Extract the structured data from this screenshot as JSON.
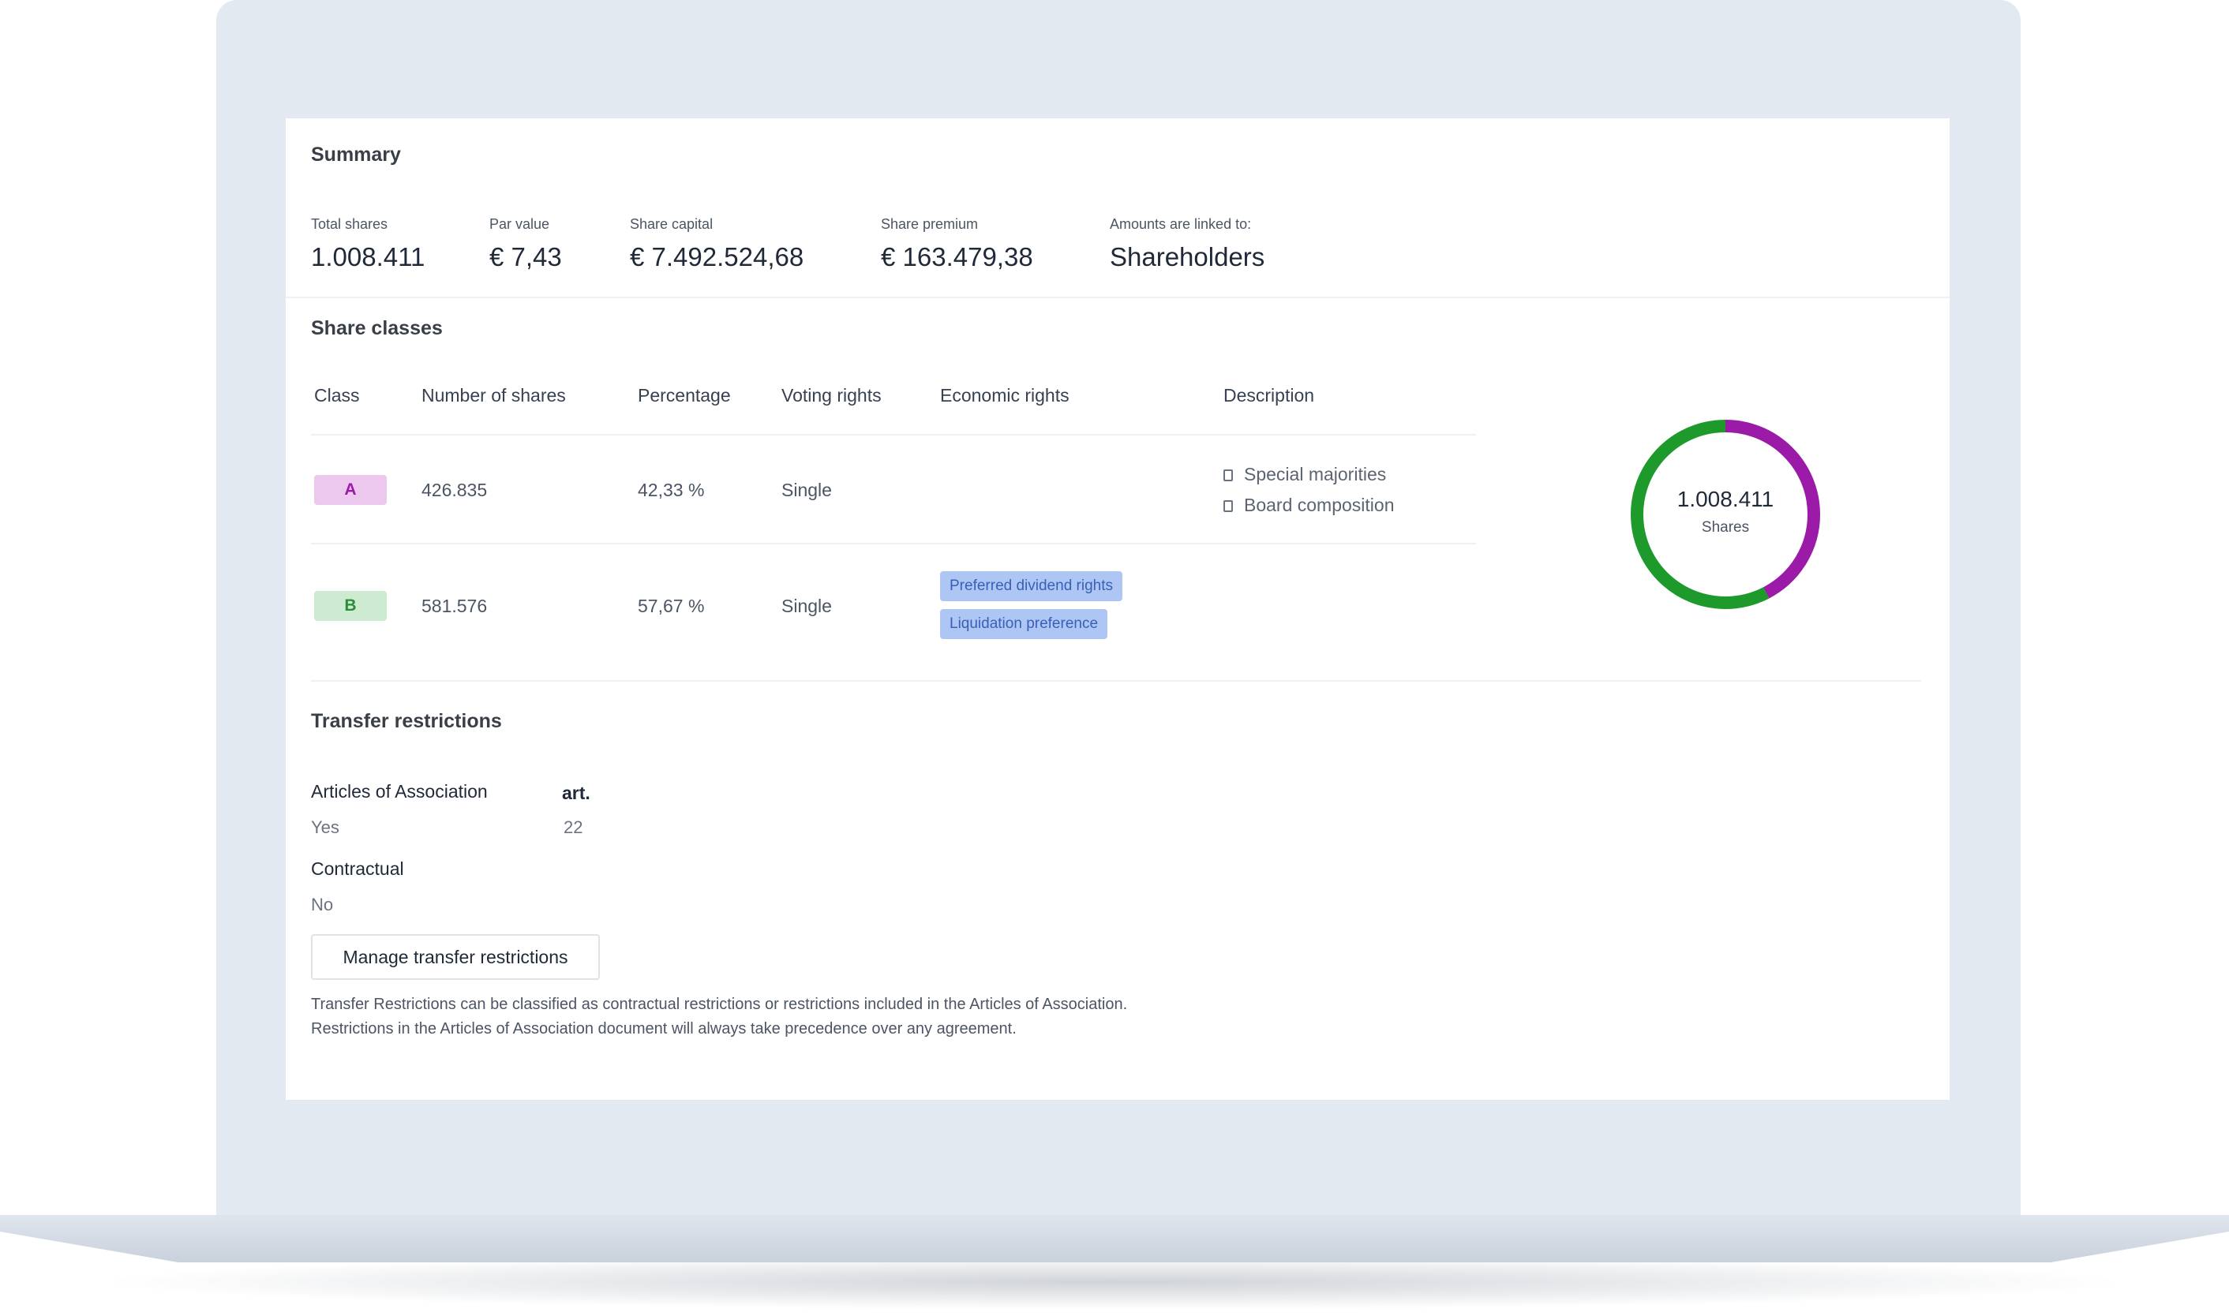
{
  "summary": {
    "title": "Summary",
    "metrics": [
      {
        "label": "Total shares",
        "value": "1.008.411"
      },
      {
        "label": "Par value",
        "value": "€ 7,43"
      },
      {
        "label": "Share capital",
        "value": "€ 7.492.524,68"
      },
      {
        "label": "Share premium",
        "value": "€ 163.479,38"
      },
      {
        "label": "Amounts are linked to:",
        "value": "Shareholders"
      }
    ]
  },
  "share_classes": {
    "title": "Share classes",
    "columns": [
      "Class",
      "Number of shares",
      "Percentage",
      "Voting rights",
      "Economic rights",
      "Description"
    ],
    "rows": [
      {
        "class": "A",
        "shares": "426.835",
        "percentage": "42,33 %",
        "voting": "Single",
        "economic": [],
        "description": [
          "Special majorities",
          "Board composition"
        ]
      },
      {
        "class": "B",
        "shares": "581.576",
        "percentage": "57,67 %",
        "voting": "Single",
        "economic": [
          "Preferred dividend rights",
          "Liquidation preference"
        ],
        "description": []
      }
    ],
    "donut": {
      "total": "1.008.411",
      "label": "Shares",
      "segments": [
        {
          "class": "A",
          "fraction": 0.4233,
          "color": "#9b1aa7"
        },
        {
          "class": "B",
          "fraction": 0.5767,
          "color": "#1e9a2c"
        }
      ]
    }
  },
  "transfer": {
    "title": "Transfer restrictions",
    "aoa_label": "Articles of Association",
    "aoa_value": "Yes",
    "art_label": "art.",
    "art_value": "22",
    "contractual_label": "Contractual",
    "contractual_value": "No",
    "button": "Manage transfer restrictions",
    "note_line1": "Transfer Restrictions can be classified as contractual restrictions or restrictions included in the Articles of Association.",
    "note_line2": "Restrictions in the Articles of Association document will always take precedence over any agreement."
  },
  "colors": {
    "class_a": "#9b1aa7",
    "class_b": "#1e9a2c",
    "chip_bg": "#adc6f3"
  }
}
